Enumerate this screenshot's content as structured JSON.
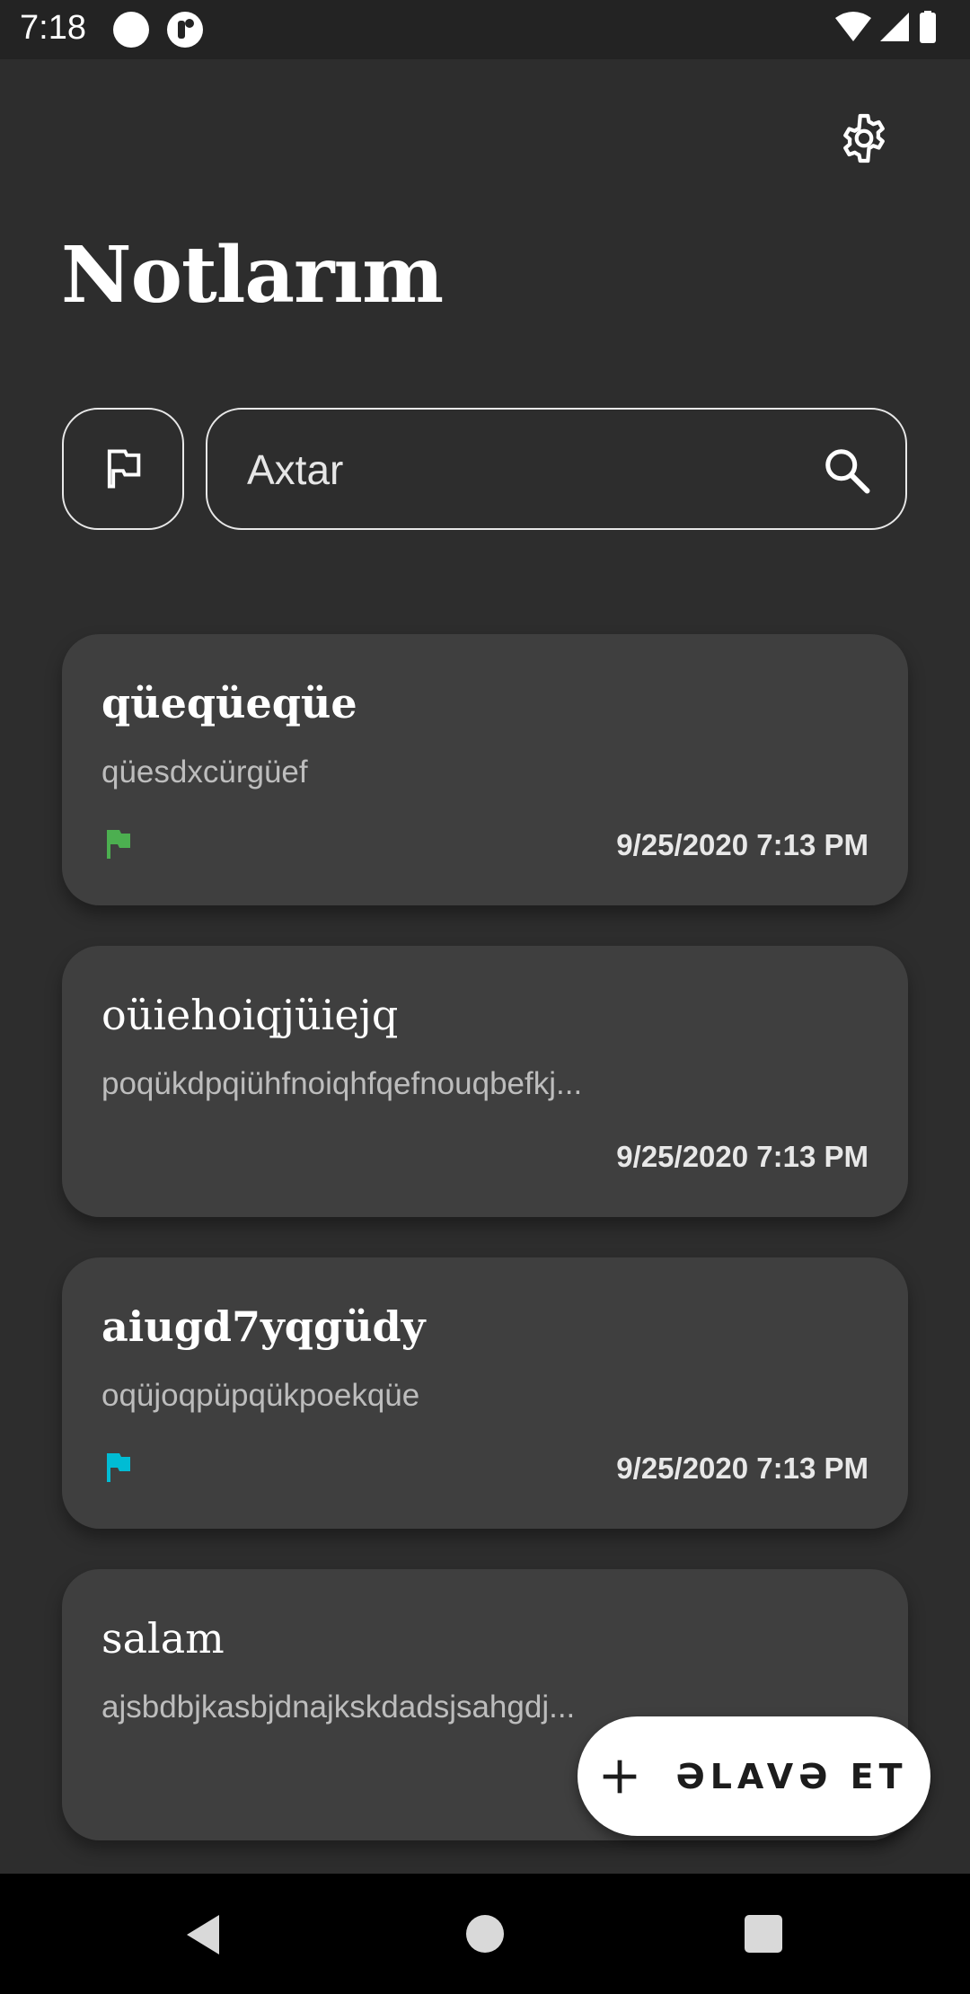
{
  "status_bar": {
    "time": "7:18"
  },
  "header": {
    "title": "Notlarım"
  },
  "search": {
    "placeholder": "Axtar",
    "value": ""
  },
  "notes": [
    {
      "title": "qüeqüeqüe",
      "body": "qüesdxcürgüef",
      "date": "9/25/2020 7:13 PM",
      "flag_color": "#4caf50",
      "bold": true
    },
    {
      "title": "oüiehoiqjüiejq",
      "body": "poqükdpqiühfnoiqhfqefnouqbefkj...",
      "date": "9/25/2020 7:13 PM",
      "flag_color": null,
      "bold": false
    },
    {
      "title": "aiugd7yqgüdy",
      "body": "oqüjoqpüpqükpoekqüe",
      "date": "9/25/2020 7:13 PM",
      "flag_color": "#00bcd4",
      "bold": true
    },
    {
      "title": "salam",
      "body": "ajsbdbjkasbjdnajkskdadsjsahgdj...",
      "date": "",
      "flag_color": null,
      "bold": false
    }
  ],
  "fab": {
    "label": "ƏLAVƏ ET"
  },
  "colors": {
    "background": "#2d2d2d",
    "card": "#3f3f3f",
    "accent_green": "#4caf50",
    "accent_cyan": "#00bcd4"
  }
}
